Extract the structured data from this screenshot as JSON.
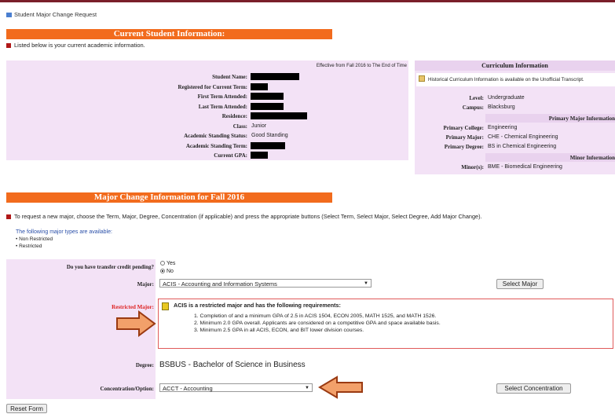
{
  "page": {
    "title": "Student Major Change Request"
  },
  "current": {
    "header": "Current Student Information:",
    "intro": "Listed below is your current academic information.",
    "effective": "Effective from Fall 2016 to The End of Time",
    "fields": [
      {
        "label": "Student Name:",
        "value": ""
      },
      {
        "label": "Registered for Current Term:",
        "value": ""
      },
      {
        "label": "First Term Attended:",
        "value": ""
      },
      {
        "label": "Last Term Attended:",
        "value": ""
      },
      {
        "label": "Residence:",
        "value": ""
      },
      {
        "label": "Class:",
        "value": "Junior"
      },
      {
        "label": "Academic Standing Status:",
        "value": "Good Standing"
      },
      {
        "label": "Academic Standing Term:",
        "value": ""
      },
      {
        "label": "Current GPA:",
        "value": ""
      }
    ]
  },
  "curriculum": {
    "header": "Curriculum Information",
    "note": "Historical Curriculum Information is available on the Unofficial Transcript.",
    "level_label": "Level:",
    "level": "Undergraduate",
    "campus_label": "Campus:",
    "campus": "Blacksburg",
    "primary_header": "Primary Major Information",
    "college_label": "Primary College:",
    "college": "Engineering",
    "major_label": "Primary Major:",
    "major": "CHE - Chemical Engineering",
    "degree_label": "Primary Degree:",
    "degree": "BS in Chemical Engineering",
    "minor_header": "Minor Information",
    "minors_label": "Minor(s):",
    "minors": "BME - Biomedical Engineering"
  },
  "change": {
    "header": "Major Change Information for Fall 2016",
    "instructions": "To request a new major, choose the Term, Major, Degree, Concentration (if applicable) and press the appropriate buttons (Select Term, Select Major, Select Degree, Add Major Change).",
    "types_title": "The following major types are available:",
    "types": [
      "• Non Restricted",
      "• Restricted"
    ],
    "transfer_label": "Do you have transfer credit pending?",
    "yes": "Yes",
    "no": "No",
    "major_label": "Major:",
    "major_value": "ACIS - Accounting and Information Systems",
    "select_major": "Select Major",
    "restricted_label": "Restricted Major:",
    "restricted_title": "ACIS is a restricted major and has the following requirements:",
    "requirements": [
      "1. Completion of and a minimum GPA of 2.5 in ACIS 1504, ECON 2005, MATH 1525, and MATH 1526.",
      "2. Minimum 2.0 GPA overall. Applicants are considered on a competitive GPA and space available basis.",
      "3. Minimum 2.5 GPA in all ACIS, ECON, and BIT lower division courses."
    ],
    "degree_label": "Degree:",
    "degree_value": "BSBUS - Bachelor of Science in Business",
    "conc_label": "Concentration/Option:",
    "conc_value": "ACCT - Accounting",
    "select_conc": "Select Concentration",
    "reset": "Reset Form"
  },
  "colors": {
    "accent": "#f26b1d",
    "panel": "#f3e2f6",
    "arrow": "#e8682a"
  }
}
